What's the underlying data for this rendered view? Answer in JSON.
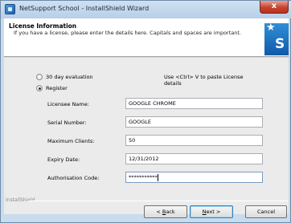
{
  "window": {
    "title": "NetSupport School - InstallShield Wizard",
    "close_label": "x"
  },
  "header": {
    "title": "License Information",
    "description": "If you have a license, please enter the details here. Capitals and spaces are important."
  },
  "options": {
    "evaluation_label": "30 day evaluation",
    "register_label": "Register",
    "selected": "register"
  },
  "hint": "Use <Ctrl> V to paste License details",
  "fields": {
    "licensee_label": "Licensee Name:",
    "licensee_value": "GOOGLE CHROME",
    "serial_label": "Serial Number:",
    "serial_value": "GOOGLE",
    "max_clients_label": "Maximum Clients:",
    "max_clients_value": "50",
    "expiry_label": "Expiry Date:",
    "expiry_value": "12/31/2012",
    "auth_label": "Authorisation Code:",
    "auth_value": "***********"
  },
  "footer": {
    "brand": "InstallShield",
    "back_prefix": "< ",
    "back_accel": "B",
    "back_suffix": "ack",
    "next_accel": "N",
    "next_suffix": "ext >",
    "cancel_label": "Cancel"
  },
  "colors": {
    "frame": "#c9dcee",
    "close_button": "#c7422d",
    "logo": "#1a73c4",
    "body": "#ebebeb"
  }
}
